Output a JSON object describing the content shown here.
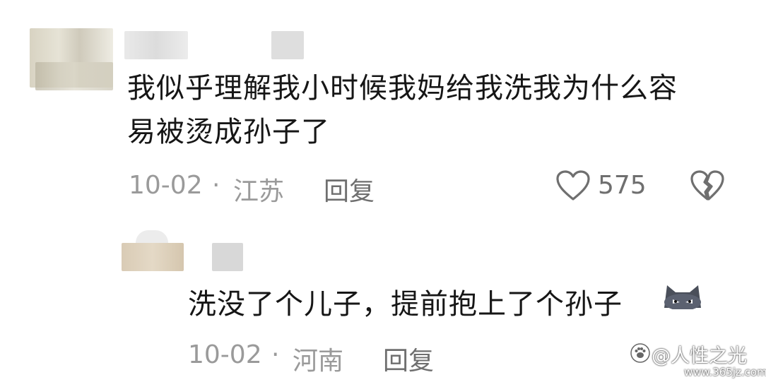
{
  "comments": [
    {
      "text_line1": "我似乎理解我小时候我妈给我洗我为什么容",
      "text_line2": "易被烫成孙子了",
      "date": "10-02",
      "separator": "·",
      "location": "江苏",
      "reply_label": "回复",
      "like_count": "575"
    },
    {
      "text": "洗没了个儿子，提前抱上了个孙子",
      "emoji": "cat-face-emoji",
      "date": "10-02",
      "separator": "·",
      "location": "河南",
      "reply_label": "回复"
    }
  ],
  "watermark": {
    "line1": "@人性之光",
    "line2": "www.365jz.com"
  },
  "icons": {
    "like": "heart-outline-icon",
    "dislike": "broken-heart-icon",
    "watermark_logo": "paw-icon"
  }
}
